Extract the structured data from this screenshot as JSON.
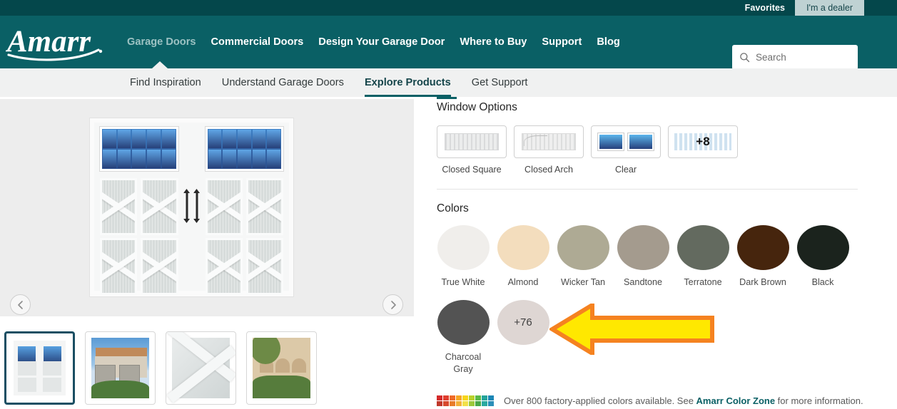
{
  "utility_bar": {
    "favorites_label": "Favorites",
    "dealer_label": "I'm a dealer"
  },
  "header": {
    "logo_text": "Amarr",
    "nav": [
      {
        "label": "Garage Doors",
        "active": true
      },
      {
        "label": "Commercial Doors",
        "active": false
      },
      {
        "label": "Design Your Garage Door",
        "active": false
      },
      {
        "label": "Where to Buy",
        "active": false
      },
      {
        "label": "Support",
        "active": false
      },
      {
        "label": "Blog",
        "active": false
      }
    ],
    "search": {
      "placeholder": "Search",
      "value": "",
      "icon": "search-icon"
    }
  },
  "subnav": [
    {
      "label": "Find Inspiration",
      "active": false
    },
    {
      "label": "Understand Garage Doors",
      "active": false
    },
    {
      "label": "Explore Products",
      "active": true
    },
    {
      "label": "Get Support",
      "active": false
    }
  ],
  "viewer": {
    "prev_icon": "chevron-left-icon",
    "next_icon": "chevron-right-icon",
    "thumbnails": [
      {
        "name": "garage-door-render",
        "selected": true
      },
      {
        "name": "house-exterior-photo",
        "selected": false
      },
      {
        "name": "door-detail-closeup",
        "selected": false
      },
      {
        "name": "stucco-home-photo",
        "selected": false
      }
    ]
  },
  "window_options": {
    "title": "Window Options",
    "items": [
      {
        "label": "Closed Square",
        "swatch": "closed-square-swatch"
      },
      {
        "label": "Closed Arch",
        "swatch": "closed-arch-swatch"
      },
      {
        "label": "Clear",
        "swatch": "clear-window-swatch"
      },
      {
        "label": "+8",
        "swatch": "more-windows-swatch"
      }
    ]
  },
  "colors": {
    "title": "Colors",
    "row1": [
      {
        "label": "True White",
        "hex": "#f0eeeb"
      },
      {
        "label": "Almond",
        "hex": "#f3ddbd"
      },
      {
        "label": "Wicker Tan",
        "hex": "#aeaa94"
      },
      {
        "label": "Sandtone",
        "hex": "#a49b8e"
      },
      {
        "label": "Terratone",
        "hex": "#636a5f"
      },
      {
        "label": "Dark Brown",
        "hex": "#46250d"
      },
      {
        "label": "Black",
        "hex": "#1b231d"
      }
    ],
    "row2": [
      {
        "label": "Charcoal Gray",
        "hex": "#535353"
      },
      {
        "label": "+76",
        "hex": "#ded6d3",
        "is_more": true
      }
    ]
  },
  "footnote": {
    "text_before": "Over 800 factory-applied colors available. See ",
    "link_text": "Amarr Color Zone",
    "text_after": " for more information.",
    "palette_colors": [
      "#d42a2a",
      "#e03f2f",
      "#ef6a26",
      "#f6a623",
      "#f7d51b",
      "#b9d12a",
      "#5bb947",
      "#23a39a",
      "#1b86b5",
      "#c0392b",
      "#d84a2e",
      "#e87c2a",
      "#f3b13a",
      "#f2e04a",
      "#9cc93b",
      "#4aa84a",
      "#2aa9a0",
      "#2b8fb8"
    ]
  },
  "annotation": {
    "arrow": {
      "fill": "#ffe800",
      "stroke": "#f58220",
      "direction": "left"
    }
  }
}
